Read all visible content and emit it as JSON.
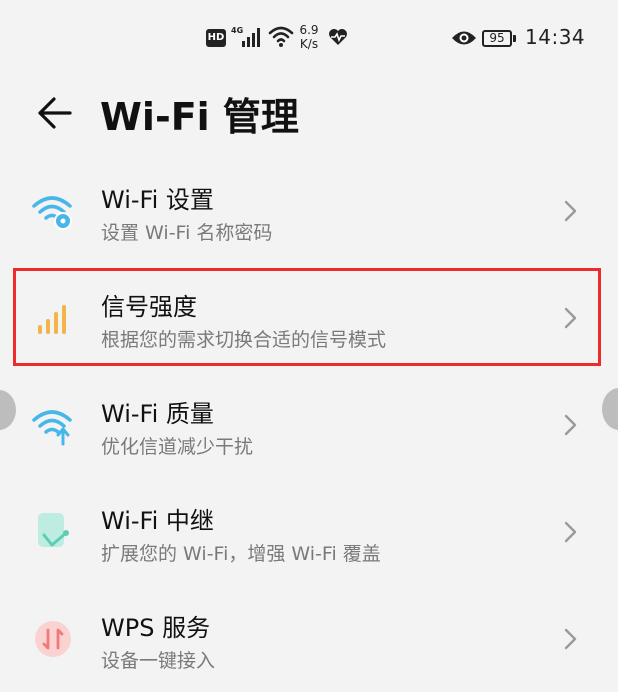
{
  "status_bar": {
    "hd": "HD",
    "network": "4G",
    "speed_value": "6.9",
    "speed_unit": "K/s",
    "battery": "95",
    "time": "14:34",
    "icons": [
      "hd-icon",
      "signal-4g-icon",
      "wifi-icon",
      "heart-icon",
      "eye-icon",
      "battery-icon"
    ]
  },
  "header": {
    "back_icon": "arrow-left-icon",
    "title": "Wi-Fi 管理"
  },
  "items": [
    {
      "title": "Wi-Fi 设置",
      "subtitle": "设置 Wi-Fi 名称密码",
      "icon": "wifi-settings-icon",
      "color": "#47b6e8"
    },
    {
      "title": "信号强度",
      "subtitle": "根据您的需求切换合适的信号模式",
      "icon": "signal-bars-icon",
      "color": "#f3b44a",
      "highlighted": true
    },
    {
      "title": "Wi-Fi 质量",
      "subtitle": "优化信道减少干扰",
      "icon": "wifi-quality-icon",
      "color": "#47b6e8"
    },
    {
      "title": "Wi-Fi 中继",
      "subtitle": "扩展您的 Wi-Fi，增强 Wi-Fi 覆盖",
      "icon": "wifi-relay-icon",
      "color": "#5fcdb3"
    },
    {
      "title": "WPS 服务",
      "subtitle": "设备一键接入",
      "icon": "wps-icon",
      "color": "#f07a7a"
    }
  ],
  "colors": {
    "highlight": "#ee2a2a",
    "background": "#f3f3f3"
  }
}
